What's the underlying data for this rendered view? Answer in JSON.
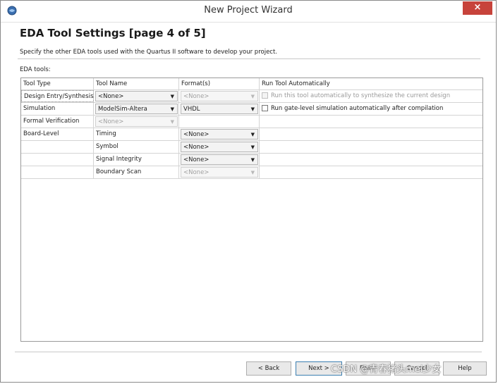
{
  "window": {
    "title": "New Project Wizard",
    "close_symbol": "×"
  },
  "page": {
    "heading": "EDA Tool Settings [page 4 of 5]",
    "description": "Specify the other EDA tools used with the Quartus II software to develop your project.",
    "eda_label": "EDA tools:"
  },
  "table": {
    "headers": [
      "Tool Type",
      "Tool Name",
      "Format(s)",
      "Run Tool Automatically"
    ],
    "rows": [
      {
        "type": "Design Entry/Synthesis",
        "name": "<None>",
        "format": "<None>",
        "format_enabled": false,
        "run": "Run this tool automatically to synthesize the current design",
        "run_enabled": false
      },
      {
        "type": "Simulation",
        "name": "ModelSim-Altera",
        "format": "VHDL",
        "format_enabled": true,
        "run": "Run gate-level simulation automatically after compilation",
        "run_enabled": true
      },
      {
        "type": "Formal Verification",
        "name": "<None>",
        "name_enabled": false
      },
      {
        "type": "Board-Level",
        "name": "Timing",
        "format": "<None>",
        "format_enabled": true
      },
      {
        "type": "",
        "name": "Symbol",
        "format": "<None>",
        "format_enabled": true
      },
      {
        "type": "",
        "name": "Signal Integrity",
        "format": "<None>",
        "format_enabled": true
      },
      {
        "type": "",
        "name": "Boundary Scan",
        "format": "<None>",
        "format_enabled": false
      }
    ]
  },
  "buttons": {
    "back": "< Back",
    "next": "Next >",
    "finish": "Finish",
    "cancel": "Cancel",
    "help": "Help"
  },
  "watermark": "CSDN @青春猪头mei少女",
  "icons": {
    "app": "quartus-globe-icon",
    "dropdown": "chevron-down-icon"
  },
  "colors": {
    "close_button": "#c7433b",
    "default_button_border": "#3c7fb1"
  }
}
